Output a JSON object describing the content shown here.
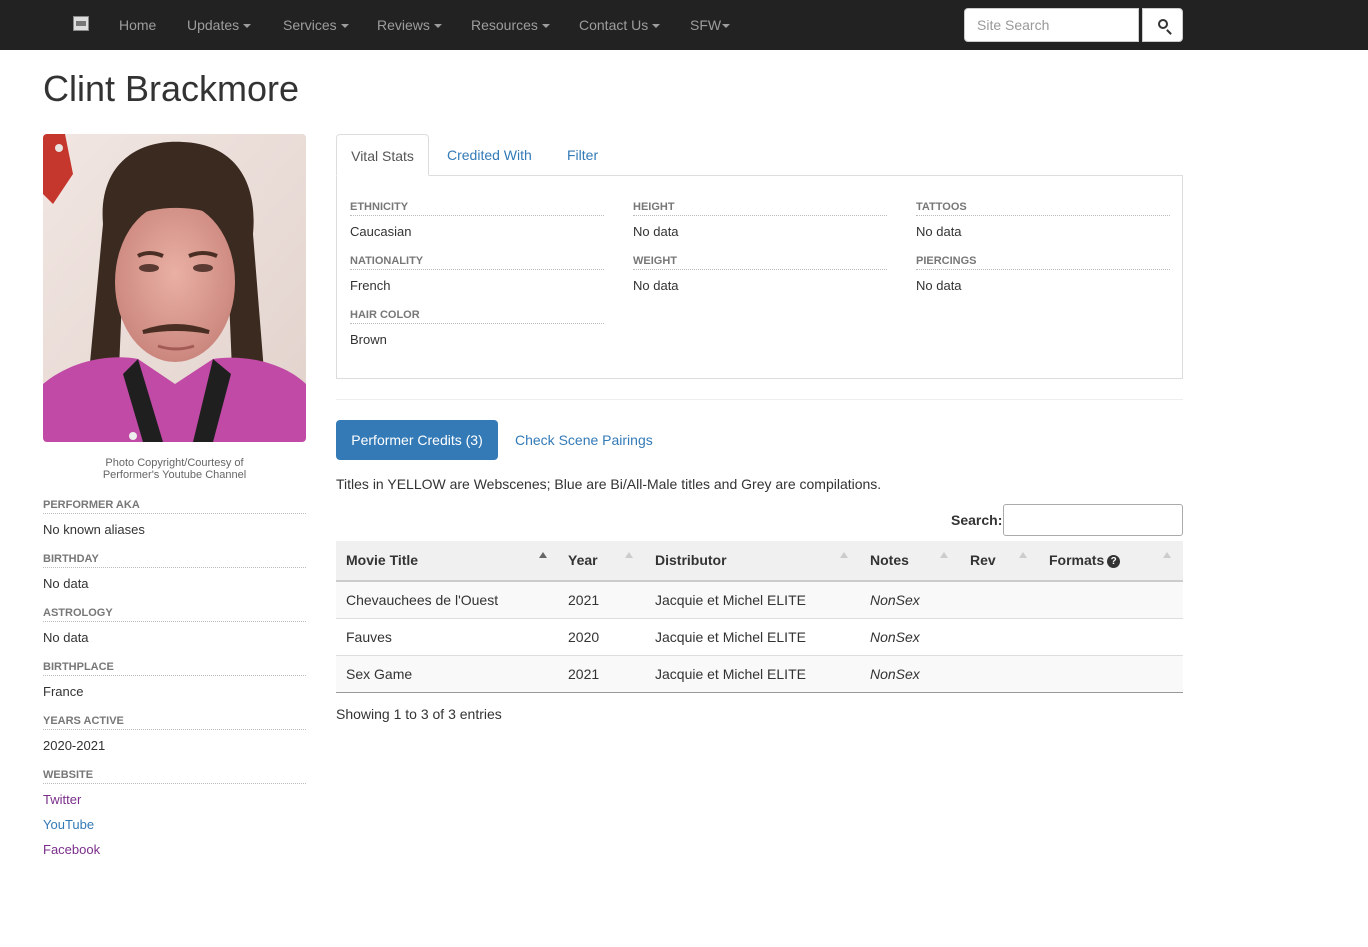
{
  "nav": {
    "items": [
      {
        "label": "Home",
        "dropdown": false
      },
      {
        "label": "Updates",
        "dropdown": true
      },
      {
        "label": "Services",
        "dropdown": true
      },
      {
        "label": "Reviews",
        "dropdown": true
      },
      {
        "label": "Resources",
        "dropdown": true
      },
      {
        "label": "Contact Us",
        "dropdown": true
      },
      {
        "label": "SFW",
        "dropdown": true
      }
    ],
    "search_placeholder": "Site Search"
  },
  "performer": {
    "name": "Clint Brackmore",
    "photo_credit_line1": "Photo Copyright/Courtesy of",
    "photo_credit_line2": "Performer's Youtube Channel"
  },
  "bio": [
    {
      "heading": "Performer AKA",
      "value": "No known aliases"
    },
    {
      "heading": "Birthday",
      "value": "No data"
    },
    {
      "heading": "Astrology",
      "value": "No data"
    },
    {
      "heading": "Birthplace",
      "value": "France"
    },
    {
      "heading": "Years Active",
      "value": "2020-2021"
    }
  ],
  "website": {
    "heading": "Website",
    "links": [
      {
        "label": "Twitter",
        "color": "#7a2e8a"
      },
      {
        "label": "YouTube",
        "color": "#337ab7"
      },
      {
        "label": "Facebook",
        "color": "#7a2e8a"
      }
    ]
  },
  "tabs": [
    "Vital Stats",
    "Credited With",
    "Filter"
  ],
  "vital_stats": [
    {
      "heading": "Ethnicity",
      "value": "Caucasian"
    },
    {
      "heading": "Nationality",
      "value": "French"
    },
    {
      "heading": "Hair Color",
      "value": "Brown"
    },
    {
      "heading": "Height",
      "value": "No data"
    },
    {
      "heading": "Weight",
      "value": "No data"
    },
    {
      "heading": "Tattoos",
      "value": "No data"
    },
    {
      "heading": "Piercings",
      "value": "No data"
    }
  ],
  "credits": {
    "pill_active": "Performer Credits (3)",
    "pill_other": "Check Scene Pairings",
    "legend_note": "Titles in YELLOW are Webscenes; Blue are Bi/All-Male titles and Grey are compilations.",
    "search_label": "Search:",
    "columns": [
      "Movie Title",
      "Year",
      "Distributor",
      "Notes",
      "Rev",
      "Formats"
    ],
    "rows": [
      {
        "title": "Chevauchees de l'Ouest",
        "year": "2021",
        "distributor": "Jacquie et Michel ELITE",
        "notes": "NonSex",
        "rev": "",
        "formats": ""
      },
      {
        "title": "Fauves",
        "year": "2020",
        "distributor": "Jacquie et Michel ELITE",
        "notes": "NonSex",
        "rev": "",
        "formats": ""
      },
      {
        "title": "Sex Game",
        "year": "2021",
        "distributor": "Jacquie et Michel ELITE",
        "notes": "NonSex",
        "rev": "",
        "formats": ""
      }
    ],
    "info": "Showing 1 to 3 of 3 entries"
  }
}
